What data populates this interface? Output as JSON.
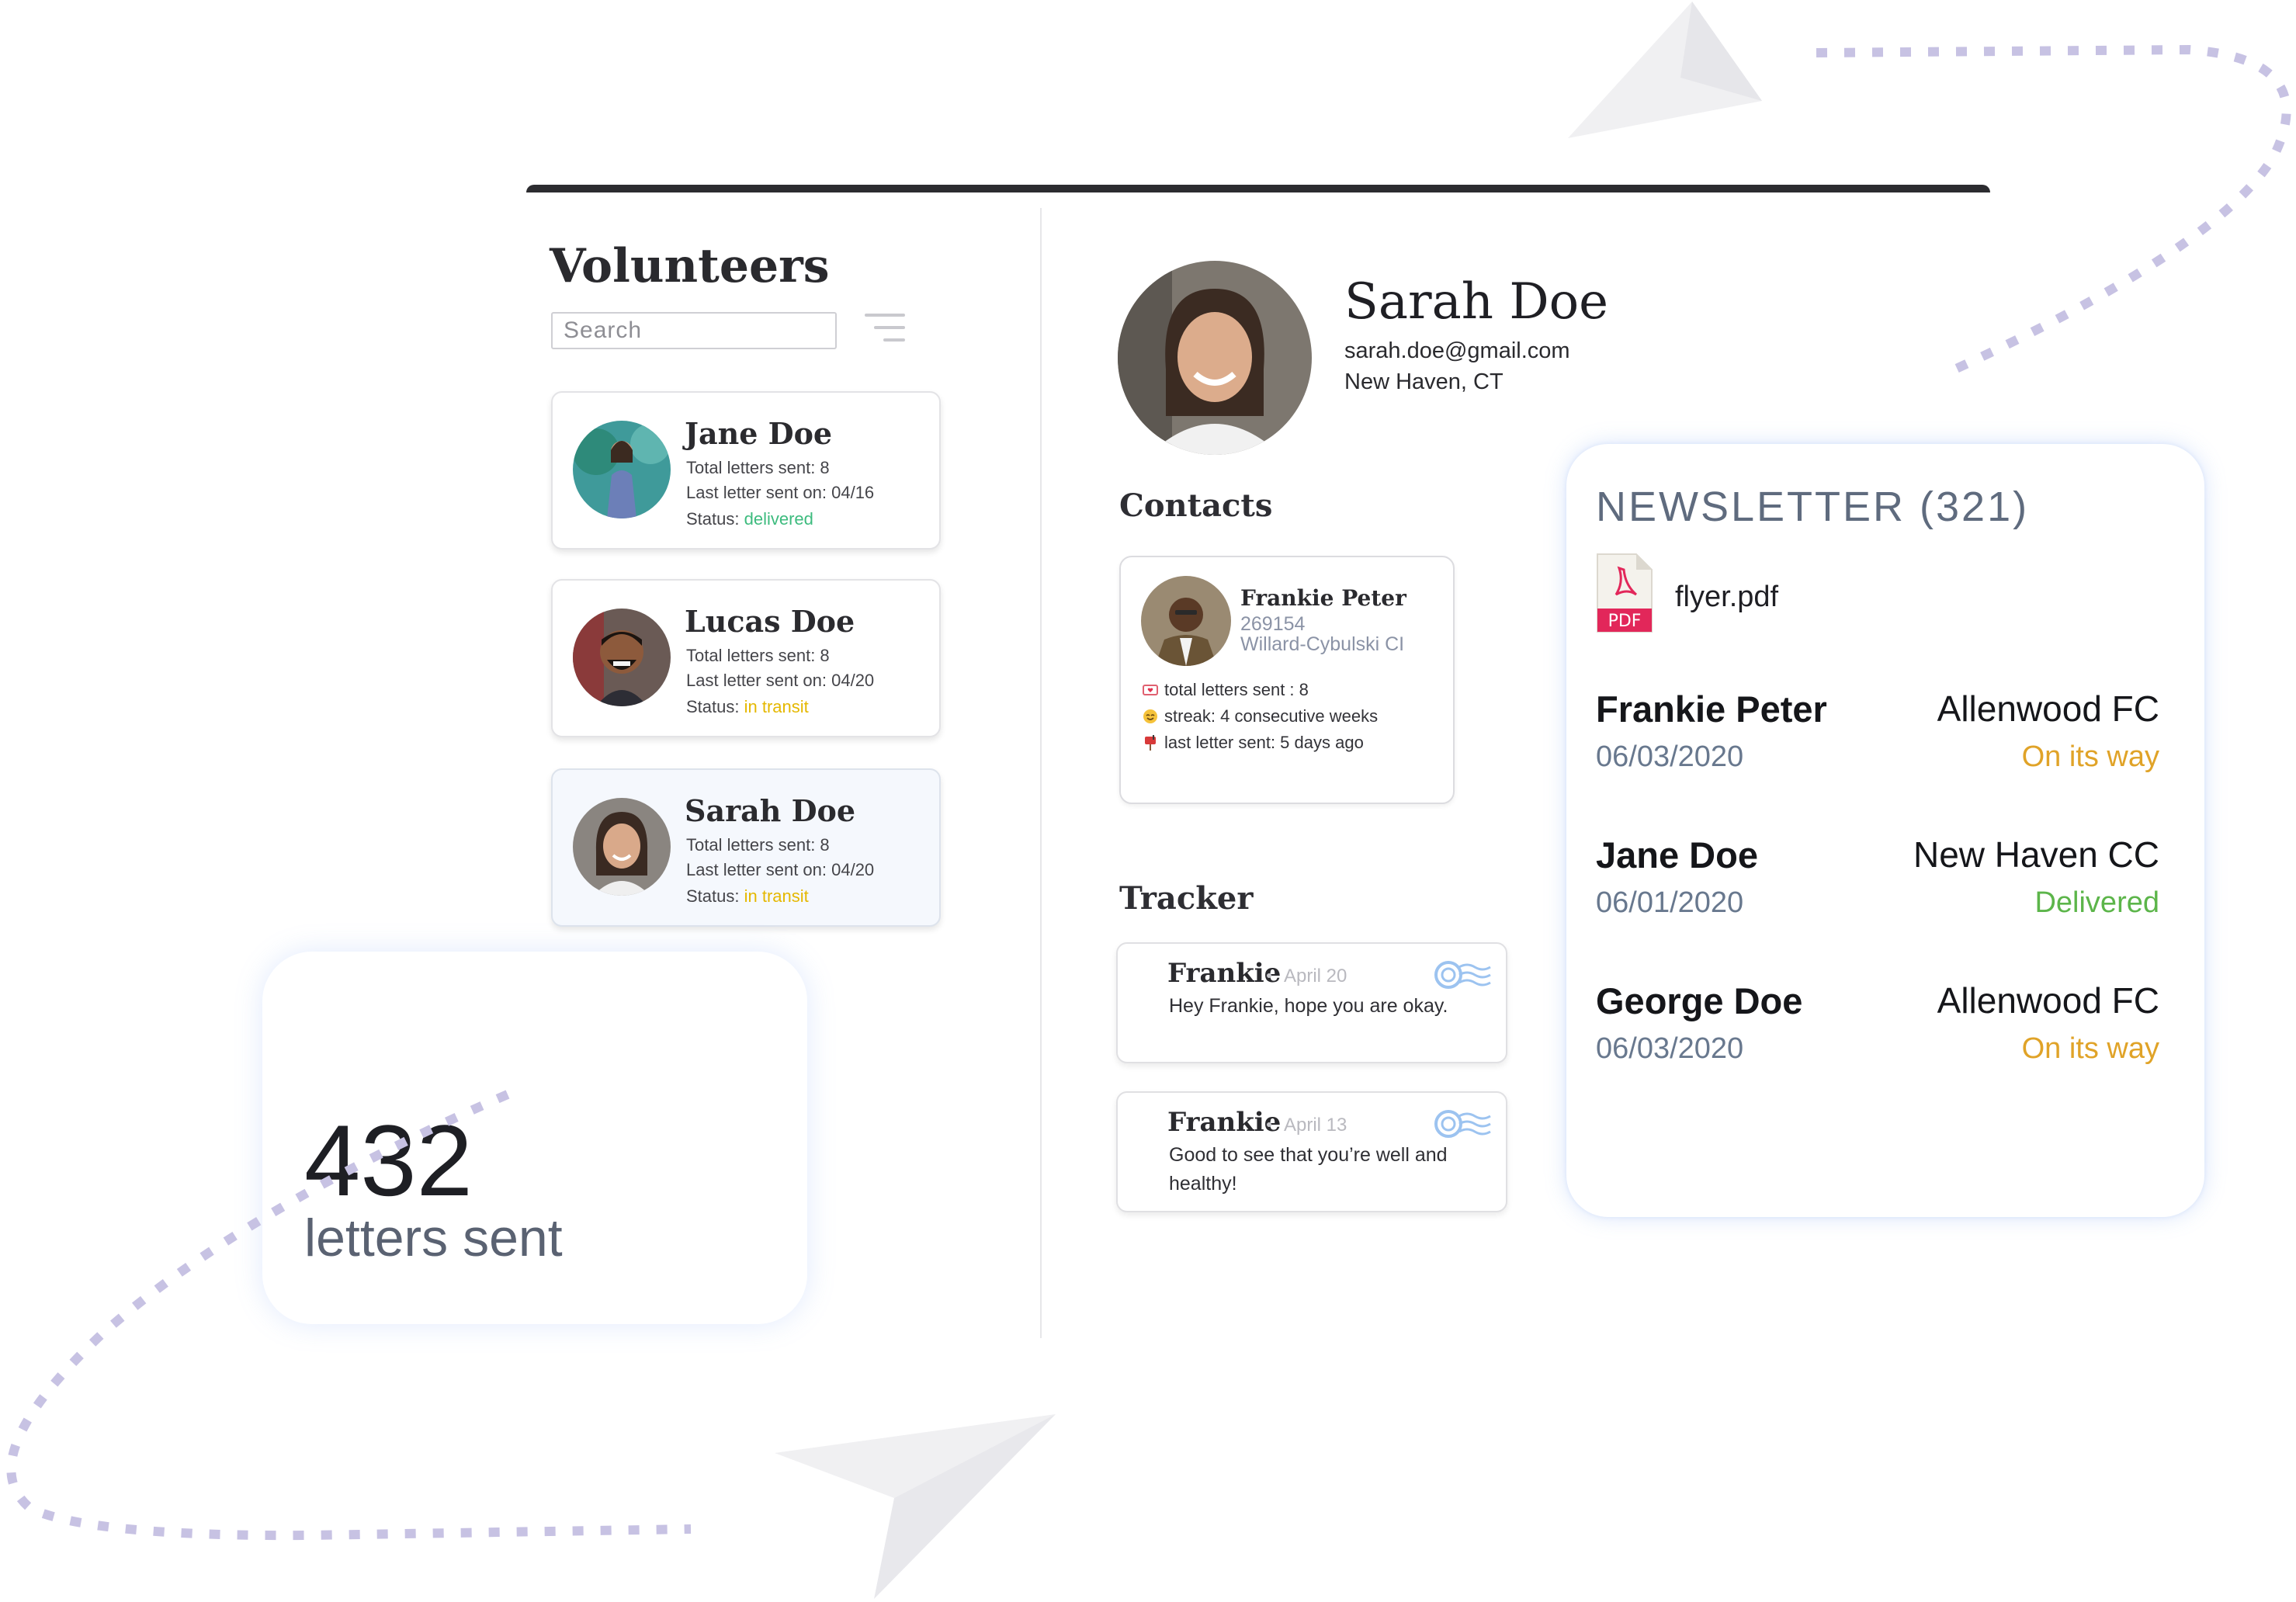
{
  "volunteers": {
    "title": "Volunteers",
    "search_placeholder": "Search",
    "cards": [
      {
        "name": "Jane Doe",
        "letters": "Total letters sent: 8",
        "last_sent": "Last letter sent on: 04/16",
        "status_label": "Status: ",
        "status": "delivered"
      },
      {
        "name": "Lucas Doe",
        "letters": "Total letters sent: 8",
        "last_sent": "Last letter sent on: 04/20",
        "status_label": "Status: ",
        "status": "in transit"
      },
      {
        "name": "Sarah Doe",
        "letters": "Total letters sent: 8",
        "last_sent": "Last letter sent on: 04/20",
        "status_label": "Status: ",
        "status": "in transit"
      }
    ]
  },
  "profile": {
    "name": "Sarah Doe",
    "email": "sarah.doe@gmail.com",
    "location": "New Haven, CT"
  },
  "contacts": {
    "title": "Contacts",
    "card": {
      "name": "Frankie Peter",
      "id": "269154",
      "street": "Willard-Cybulski CI",
      "total_letters": "total letters sent : 8",
      "streak": "streak: 4 consecutive weeks",
      "last_sent": "last letter sent: 5 days ago"
    }
  },
  "tracker": {
    "title": "Tracker",
    "items": [
      {
        "name": "Frankie",
        "date": "April 20",
        "message": "Hey Frankie, hope you are okay."
      },
      {
        "name": "Frankie",
        "date": "April 13",
        "message": "Good to see that you’re well and healthy!"
      }
    ]
  },
  "newsletter": {
    "title": "NEWSLETTER (321)",
    "file": "flyer.pdf",
    "file_badge": "PDF",
    "rows": [
      {
        "name": "Frankie Peter",
        "date": "06/03/2020",
        "club": "Allenwood FC",
        "status": "On its way"
      },
      {
        "name": "Jane Doe",
        "date": "06/01/2020",
        "club": "New Haven CC",
        "status": "Delivered"
      },
      {
        "name": "George Doe",
        "date": "06/03/2020",
        "club": "Allenwood FC",
        "status": "On its way"
      }
    ]
  },
  "stats": {
    "letters_count": "432",
    "letters_label": "letters sent"
  },
  "colors": {
    "delivered": "#3dbb7e",
    "in_transit": "#e5b800",
    "on_its_way": "#e0a328",
    "newsletter_delivered": "#5cb54a",
    "dotted_path": "#c7c2e3"
  }
}
